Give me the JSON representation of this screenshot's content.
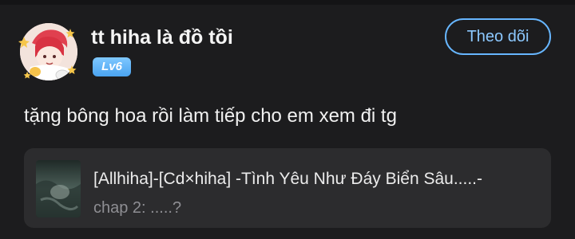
{
  "post": {
    "author": {
      "name": "tt hiha là đồ tồi",
      "level_badge": "Lv6",
      "avatar_icon": "anime-avatar-with-stars"
    },
    "follow_button_label": "Theo dõi",
    "content": "tặng bông hoa rồi làm tiếp cho em xem đi tg",
    "linked_story": {
      "title": "[Allhiha]-[Cd×hiha] -Tình Yêu Như Đáy Biển Sâu.....-",
      "chapter": "chap 2: .....?",
      "cover_icon": "story-cover-thumbnail"
    }
  },
  "colors": {
    "background": "#1c1c1e",
    "accent_blue": "#67b6ff",
    "badge_blue": "#4aa3f0",
    "card_background": "#2c2c2e",
    "muted_text": "#8e8e93"
  }
}
